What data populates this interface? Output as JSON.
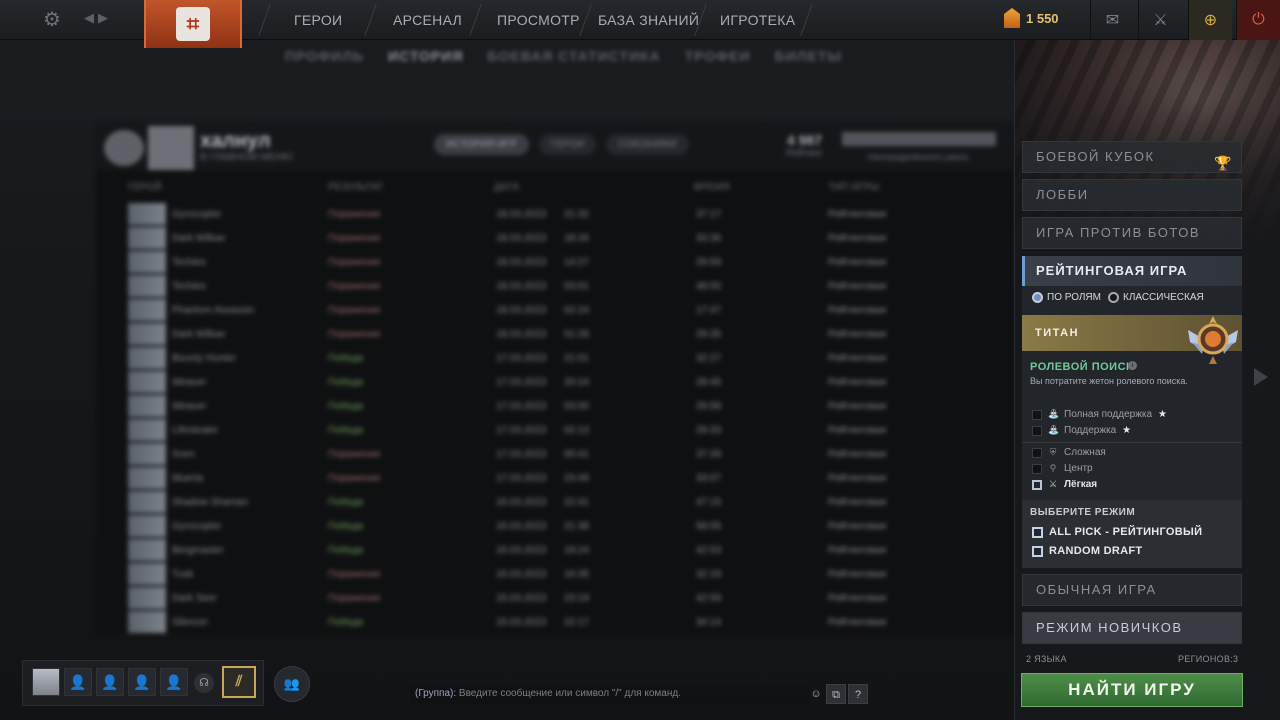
{
  "topbar": {
    "settings_icon": "gear-icon",
    "nav_back_icon": "arrow-left-icon",
    "nav_forward_icon": "arrow-right-icon",
    "logo_icon": "dota-logo-icon",
    "nav": [
      "ГЕРОИ",
      "АРСЕНАЛ",
      "ПРОСМОТР",
      "БАЗА ЗНАНИЙ",
      "ИГРОТЕКА"
    ],
    "currency": {
      "icon": "shard-icon",
      "value": "1 550"
    },
    "mail_icon": "mail-icon",
    "armory_icon": "sword-icon",
    "plus_icon": "plus-icon",
    "power_icon": "power-icon"
  },
  "profile": {
    "subnav": [
      "ПРОФИЛЬ",
      "ИСТОРИЯ",
      "БОЕВАЯ СТАТИСТИКА",
      "ТРОФЕИ",
      "БИЛЕТЫ"
    ],
    "name": "халнул",
    "status": "В ГЛАВНОМ МЕНЮ",
    "tabs": [
      "ИСТОРИЯ ИГР",
      "ГЕРОИ",
      "СОЮЗНИКИ"
    ],
    "stat_value": "4 987",
    "stat_label": "Рейтинг",
    "bar_label": "Неопределённого ранга",
    "columns": [
      "ГЕРОЙ",
      "РЕЗУЛЬТАТ",
      "ДАТА",
      "ВРЕМЯ",
      "ТИП ИГРЫ"
    ],
    "rows": [
      {
        "hero": "Gyrocopter",
        "result": "Поражение",
        "date": "18.03.2023",
        "time": "21:32",
        "dur": "37:17",
        "type": "Рейтинговая"
      },
      {
        "hero": "Dark Willow",
        "result": "Поражение",
        "date": "18.03.2023",
        "time": "18:26",
        "dur": "33:36",
        "type": "Рейтинговая"
      },
      {
        "hero": "Techies",
        "result": "Поражение",
        "date": "18.03.2023",
        "time": "14:27",
        "dur": "29:59",
        "type": "Рейтинговая"
      },
      {
        "hero": "Techies",
        "result": "Поражение",
        "date": "18.03.2023",
        "time": "03:01",
        "dur": "48:00",
        "type": "Рейтинговая"
      },
      {
        "hero": "Phantom Assassin",
        "result": "Поражение",
        "date": "18.03.2023",
        "time": "02:24",
        "dur": "17:47",
        "type": "Рейтинговая"
      },
      {
        "hero": "Dark Willow",
        "result": "Поражение",
        "date": "18.03.2023",
        "time": "01:28",
        "dur": "29:35",
        "type": "Рейтинговая"
      },
      {
        "hero": "Bounty Hunter",
        "result": "Победа",
        "date": "17.03.2023",
        "time": "21:01",
        "dur": "32:27",
        "type": "Рейтинговая"
      },
      {
        "hero": "Weaver",
        "result": "Победа",
        "date": "17.03.2023",
        "time": "20:24",
        "dur": "28:45",
        "type": "Рейтинговая"
      },
      {
        "hero": "Weaver",
        "result": "Победа",
        "date": "17.03.2023",
        "time": "03:00",
        "dur": "29:58",
        "type": "Рейтинговая"
      },
      {
        "hero": "Lifestealer",
        "result": "Победа",
        "date": "17.03.2023",
        "time": "02:13",
        "dur": "29:33",
        "type": "Рейтинговая"
      },
      {
        "hero": "Sven",
        "result": "Поражение",
        "date": "17.03.2023",
        "time": "00:41",
        "dur": "37:39",
        "type": "Рейтинговая"
      },
      {
        "hero": "Muerta",
        "result": "Поражение",
        "date": "17.03.2023",
        "time": "23:49",
        "dur": "33:07",
        "type": "Рейтинговая"
      },
      {
        "hero": "Shadow Shaman",
        "result": "Победа",
        "date": "16.03.2023",
        "time": "22:41",
        "dur": "47:15",
        "type": "Рейтинговая"
      },
      {
        "hero": "Gyrocopter",
        "result": "Победа",
        "date": "16.03.2023",
        "time": "21:38",
        "dur": "58:05",
        "type": "Рейтинговая"
      },
      {
        "hero": "Bergmaster",
        "result": "Победа",
        "date": "16.03.2023",
        "time": "19:24",
        "dur": "42:53",
        "type": "Рейтинговая"
      },
      {
        "hero": "Tusk",
        "result": "Поражение",
        "date": "16.03.2023",
        "time": "16:35",
        "dur": "32:19",
        "type": "Рейтинговая"
      },
      {
        "hero": "Dark Seer",
        "result": "Поражение",
        "date": "15.03.2023",
        "time": "23:19",
        "dur": "42:59",
        "type": "Рейтинговая"
      },
      {
        "hero": "Silencer",
        "result": "Победа",
        "date": "15.03.2023",
        "time": "22:17",
        "dur": "34:14",
        "type": "Рейтинговая"
      }
    ]
  },
  "play_panel": {
    "battle_cup": "БОЕВОЙ КУБОК",
    "battle_cup_icon": "trophy-icon",
    "lobby": "ЛОББИ",
    "bots": "ИГРА ПРОТИВ БОТОВ",
    "ranked": "РЕЙТИНГОВАЯ ИГРА",
    "radio_roles": "ПО РОЛЯМ",
    "radio_classic": "КЛАССИЧЕСКАЯ",
    "rank_name": "ТИТАН",
    "rank_medal_icon": "titan-medal-icon",
    "role_search_title": "РОЛЕВОЙ ПОИСК",
    "role_search_info_icon": "info-icon",
    "role_search_desc": "Вы потратите жетон ролевого поиска.",
    "roles": [
      {
        "label": "Полная поддержка",
        "icon": "hard-support-icon",
        "star": true,
        "checked": false
      },
      {
        "label": "Поддержка",
        "icon": "support-icon",
        "star": true,
        "checked": false
      },
      {
        "label": "Сложная",
        "icon": "offlane-icon",
        "star": false,
        "checked": false
      },
      {
        "label": "Центр",
        "icon": "mid-icon",
        "star": false,
        "checked": false
      },
      {
        "label": "Лёгкая",
        "icon": "safelane-icon",
        "star": false,
        "checked": true
      }
    ],
    "star_glyph": "★",
    "mode_title": "ВЫБЕРИТЕ РЕЖИМ",
    "modes": [
      "ALL PICK - РЕЙТИНГОВЫЙ",
      "RANDOM DRAFT"
    ],
    "unranked": "ОБЫЧНАЯ ИГРА",
    "newbie": "РЕЖИМ НОВИЧКОВ",
    "languages": "2 ЯЗЫКА",
    "regions": "РЕГИОНОВ:3",
    "find_game": "НАЙТИ ИГРУ"
  },
  "bottom": {
    "voice_icon": "headset-icon",
    "ticket_icon": "ticket-icon",
    "friends_icon": "friends-icon",
    "chat_label": "(Группа):",
    "chat_placeholder": "Введите сообщение или символ \"/\" для команд.",
    "emoji_icon": "emoji-icon",
    "chat_settings_icon": "chat-window-icon",
    "help_label": "?"
  }
}
